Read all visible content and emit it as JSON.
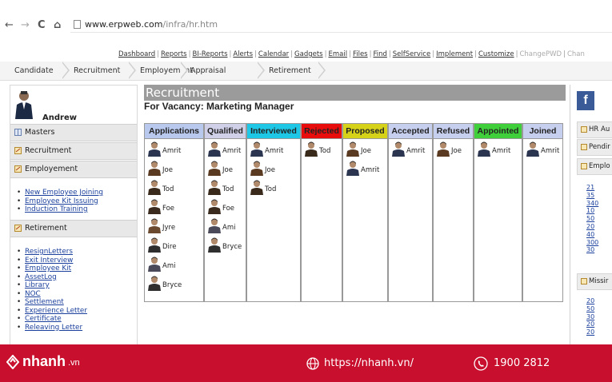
{
  "browser": {
    "back": "←",
    "forward": "→",
    "reload": "C",
    "home": "⌂",
    "url_host": "www.erpweb.com",
    "url_path": "/infra/hr.htm"
  },
  "top_links": [
    "Dashboard",
    "Reports",
    "BI-Reports",
    "Alerts",
    "Calendar",
    "Gadgets",
    "Email",
    "Files",
    "Find",
    "SelfService",
    "Implement",
    "Customize"
  ],
  "top_links_inactive": [
    "ChangePWD",
    "Chan"
  ],
  "tabs": [
    "Candidate",
    "Recruitment",
    "Employement",
    "Appraisal",
    "Retirement"
  ],
  "left": {
    "user": "Andrew",
    "sections": [
      {
        "label": "Masters"
      },
      {
        "label": "Recruitment"
      },
      {
        "label": "Employement"
      },
      {
        "label": "Retirement"
      }
    ],
    "employement_links": [
      "New Employee Joining",
      "Employee Kit Issuing",
      "Induction Training"
    ],
    "retirement_links": [
      "ResignLetters",
      "Exit Interview",
      "Employee Kit",
      "AssetLog",
      "Library",
      "NOC",
      "Settlement",
      "Experience Letter",
      "Certificate",
      "Releaving Letter"
    ]
  },
  "main": {
    "title": "Recruitment",
    "vacancy": "For Vacancy: Marketing Manager",
    "columns": [
      {
        "label": "Applications",
        "color": "#b9c9ee",
        "cards": [
          "Amrit",
          "Joe",
          "Tod",
          "Foe",
          "Jyre",
          "Dire",
          "Ami",
          "Bryce"
        ]
      },
      {
        "label": "Qualified",
        "color": "#d0d0e8",
        "cards": [
          "Amrit",
          "Joe",
          "Tod",
          "Foe",
          "Ami",
          "Bryce"
        ]
      },
      {
        "label": "Interviewed",
        "color": "#1ec7e6",
        "cards": [
          "Amrit",
          "Joe",
          "Tod"
        ]
      },
      {
        "label": "Rejected",
        "color": "#e80c0c",
        "cards": [
          "Tod"
        ]
      },
      {
        "label": "Proposed",
        "color": "#d6d21a",
        "cards": [
          "Joe",
          "Amrit"
        ]
      },
      {
        "label": "Accepted",
        "color": "#c7cfee",
        "cards": [
          "Amrit"
        ]
      },
      {
        "label": "Refused",
        "color": "#c7cfee",
        "cards": [
          "Joe"
        ]
      },
      {
        "label": "Appointed",
        "color": "#3fcf3a",
        "cards": [
          "Amrit"
        ]
      },
      {
        "label": "Joined",
        "color": "#c7cfee",
        "cards": [
          "Amrit"
        ]
      }
    ]
  },
  "right": {
    "fb": "f",
    "sections": [
      "HR Au",
      "Pendir",
      "Emplo",
      "Missir"
    ],
    "list1": [
      "21",
      "35",
      "340",
      "10",
      "50",
      "20",
      "40",
      "300",
      "30"
    ],
    "list2": [
      "20",
      "50",
      "30",
      "20",
      "20"
    ]
  },
  "banner": {
    "brand": "nhanh",
    "brand_suffix": ".vn",
    "url": "https://nhanh.vn/",
    "phone": "1900 2812"
  }
}
